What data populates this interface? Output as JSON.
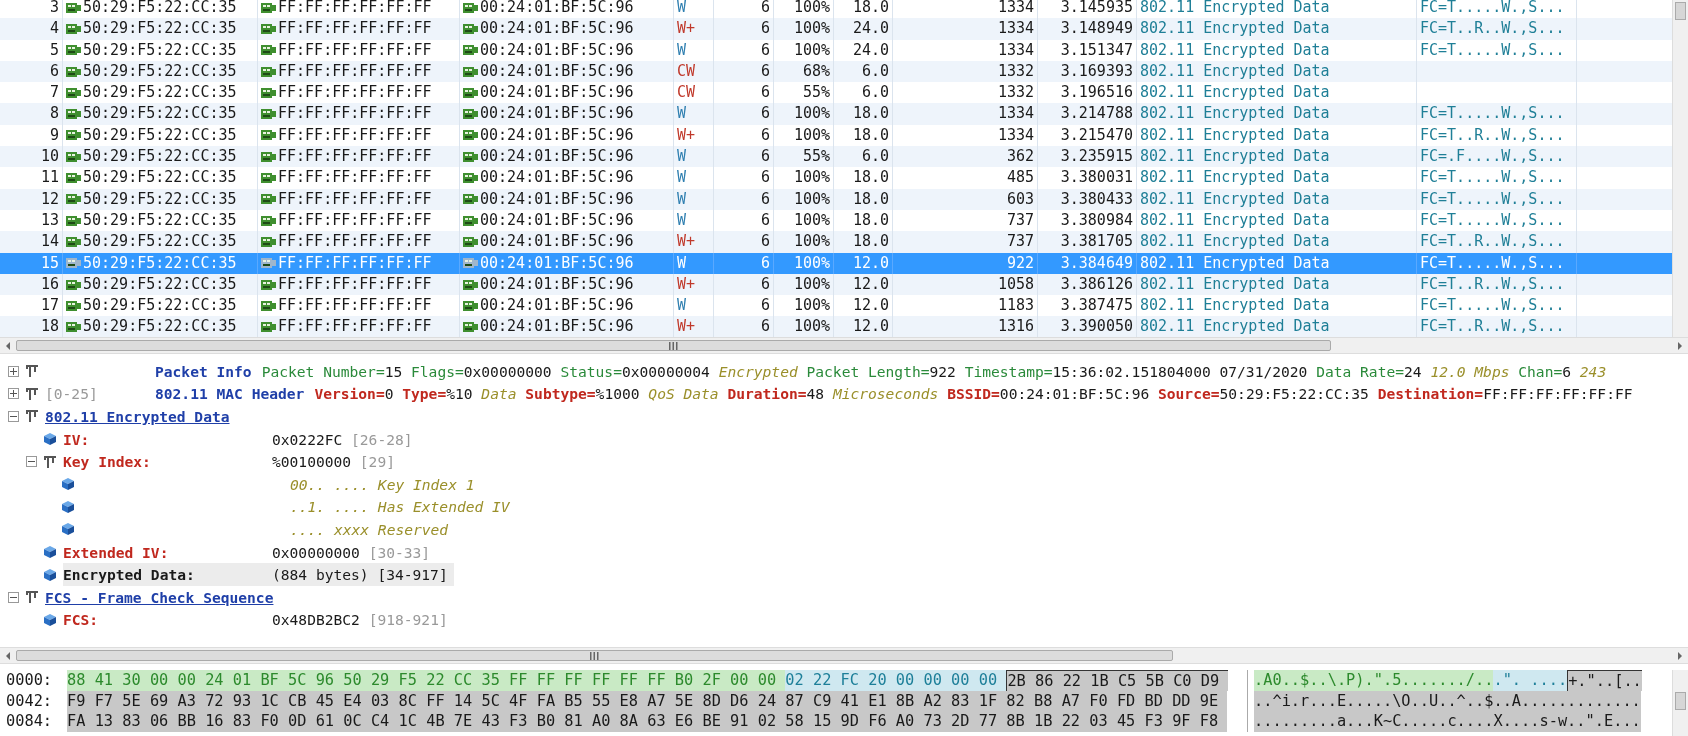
{
  "packet_list": {
    "rows": [
      {
        "selected": false,
        "color": "#2f7fb0",
        "cells": [
          "3",
          "50:29:F5:22:CC:35",
          "FF:FF:FF:FF:FF:FF",
          "00:24:01:BF:5C:96",
          "W",
          "6",
          "100%",
          "18.0",
          "1334",
          "3.145935",
          "802.11 Encrypted Data",
          "FC=T.....W.,S..."
        ]
      },
      {
        "selected": false,
        "color": "#c0392b",
        "cells": [
          "4",
          "50:29:F5:22:CC:35",
          "FF:FF:FF:FF:FF:FF",
          "00:24:01:BF:5C:96",
          "W+",
          "6",
          "100%",
          "24.0",
          "1334",
          "3.148949",
          "802.11 Encrypted Data",
          "FC=T..R..W.,S..."
        ]
      },
      {
        "selected": false,
        "color": "#2f7fb0",
        "cells": [
          "5",
          "50:29:F5:22:CC:35",
          "FF:FF:FF:FF:FF:FF",
          "00:24:01:BF:5C:96",
          "W",
          "6",
          "100%",
          "24.0",
          "1334",
          "3.151347",
          "802.11 Encrypted Data",
          "FC=T.....W.,S..."
        ]
      },
      {
        "selected": false,
        "color": "#c0392b",
        "cells": [
          "6",
          "50:29:F5:22:CC:35",
          "FF:FF:FF:FF:FF:FF",
          "00:24:01:BF:5C:96",
          "CW",
          "6",
          "68%",
          "6.0",
          "1332",
          "3.169393",
          "802.11 Encrypted Data"
        ]
      },
      {
        "selected": false,
        "color": "#c0392b",
        "cells": [
          "7",
          "50:29:F5:22:CC:35",
          "FF:FF:FF:FF:FF:FF",
          "00:24:01:BF:5C:96",
          "CW",
          "6",
          "55%",
          "6.0",
          "1332",
          "3.196516",
          "802.11 Encrypted Data"
        ]
      },
      {
        "selected": false,
        "color": "#2f7fb0",
        "cells": [
          "8",
          "50:29:F5:22:CC:35",
          "FF:FF:FF:FF:FF:FF",
          "00:24:01:BF:5C:96",
          "W",
          "6",
          "100%",
          "18.0",
          "1334",
          "3.214788",
          "802.11 Encrypted Data",
          "FC=T.....W.,S..."
        ]
      },
      {
        "selected": false,
        "color": "#c0392b",
        "cells": [
          "9",
          "50:29:F5:22:CC:35",
          "FF:FF:FF:FF:FF:FF",
          "00:24:01:BF:5C:96",
          "W+",
          "6",
          "100%",
          "18.0",
          "1334",
          "3.215470",
          "802.11 Encrypted Data",
          "FC=T..R..W.,S..."
        ]
      },
      {
        "selected": false,
        "color": "#2f7fb0",
        "cells": [
          "10",
          "50:29:F5:22:CC:35",
          "FF:FF:FF:FF:FF:FF",
          "00:24:01:BF:5C:96",
          "W",
          "6",
          "55%",
          "6.0",
          "362",
          "3.235915",
          "802.11 Encrypted Data",
          "FC=.F....W.,S..."
        ]
      },
      {
        "selected": false,
        "color": "#2f7fb0",
        "cells": [
          "11",
          "50:29:F5:22:CC:35",
          "FF:FF:FF:FF:FF:FF",
          "00:24:01:BF:5C:96",
          "W",
          "6",
          "100%",
          "18.0",
          "485",
          "3.380031",
          "802.11 Encrypted Data",
          "FC=T.....W.,S..."
        ]
      },
      {
        "selected": false,
        "color": "#2f7fb0",
        "cells": [
          "12",
          "50:29:F5:22:CC:35",
          "FF:FF:FF:FF:FF:FF",
          "00:24:01:BF:5C:96",
          "W",
          "6",
          "100%",
          "18.0",
          "603",
          "3.380433",
          "802.11 Encrypted Data",
          "FC=T.....W.,S..."
        ]
      },
      {
        "selected": false,
        "color": "#2f7fb0",
        "cells": [
          "13",
          "50:29:F5:22:CC:35",
          "FF:FF:FF:FF:FF:FF",
          "00:24:01:BF:5C:96",
          "W",
          "6",
          "100%",
          "18.0",
          "737",
          "3.380984",
          "802.11 Encrypted Data",
          "FC=T.....W.,S..."
        ]
      },
      {
        "selected": false,
        "color": "#c0392b",
        "cells": [
          "14",
          "50:29:F5:22:CC:35",
          "FF:FF:FF:FF:FF:FF",
          "00:24:01:BF:5C:96",
          "W+",
          "6",
          "100%",
          "18.0",
          "737",
          "3.381705",
          "802.11 Encrypted Data",
          "FC=T..R..W.,S..."
        ]
      },
      {
        "selected": true,
        "color": "#ffffff",
        "cells": [
          "15",
          "50:29:F5:22:CC:35",
          "FF:FF:FF:FF:FF:FF",
          "00:24:01:BF:5C:96",
          "W",
          "6",
          "100%",
          "12.0",
          "922",
          "3.384649",
          "802.11 Encrypted Data",
          "FC=T.....W.,S..."
        ]
      },
      {
        "selected": false,
        "color": "#c0392b",
        "cells": [
          "16",
          "50:29:F5:22:CC:35",
          "FF:FF:FF:FF:FF:FF",
          "00:24:01:BF:5C:96",
          "W+",
          "6",
          "100%",
          "12.0",
          "1058",
          "3.386126",
          "802.11 Encrypted Data",
          "FC=T..R..W.,S..."
        ]
      },
      {
        "selected": false,
        "color": "#2f7fb0",
        "cells": [
          "17",
          "50:29:F5:22:CC:35",
          "FF:FF:FF:FF:FF:FF",
          "00:24:01:BF:5C:96",
          "W",
          "6",
          "100%",
          "12.0",
          "1183",
          "3.387475",
          "802.11 Encrypted Data",
          "FC=T.....W.,S..."
        ]
      },
      {
        "selected": false,
        "color": "#c0392b",
        "cells": [
          "18",
          "50:29:F5:22:CC:35",
          "FF:FF:FF:FF:FF:FF",
          "00:24:01:BF:5C:96",
          "W+",
          "6",
          "100%",
          "12.0",
          "1316",
          "3.390050",
          "802.11 Encrypted Data",
          "FC=T..R..W.,S..."
        ]
      }
    ]
  },
  "decode_tree": [
    {
      "kind": "info",
      "expanded": false,
      "label": "Packet Info",
      "fields": [
        {
          "key": "Packet Number=",
          "value": "15"
        },
        {
          "key": "Flags=",
          "value": "0x00000000"
        },
        {
          "key": "Status=",
          "value": "0x00000004",
          "note": "Encrypted"
        },
        {
          "key": "Packet Length=",
          "value": "922"
        },
        {
          "key": "Timestamp=",
          "value": "15:36:02.151804000 07/31/2020"
        },
        {
          "key": "Data Rate=",
          "value": "24",
          "note": "12.0 Mbps"
        },
        {
          "key": "Chan=",
          "value": "6",
          "note": "243"
        }
      ]
    },
    {
      "kind": "header",
      "expanded": false,
      "range": "[0-25]",
      "label": "802.11 MAC Header",
      "fields": [
        {
          "key": "Version=",
          "value": "0"
        },
        {
          "key": "Type=",
          "value": "%10",
          "note": "Data"
        },
        {
          "key": "Subtype=",
          "value": "%1000",
          "note": "QoS Data"
        },
        {
          "key": "Duration=",
          "value": "48",
          "note": "Microseconds"
        },
        {
          "key": "BSSID=",
          "value": "00:24:01:BF:5C:96"
        },
        {
          "key": "Source=",
          "value": "50:29:F5:22:CC:35"
        },
        {
          "key": "Destination=",
          "value": "FF:FF:FF:FF:FF:FF"
        }
      ]
    },
    {
      "kind": "section",
      "expanded": true,
      "label": "802.11 Encrypted Data",
      "children": [
        {
          "kind": "field",
          "selected": false,
          "label": "IV:",
          "value": "0x0222FC",
          "range": "[26-28]"
        },
        {
          "kind": "field",
          "selected": false,
          "expanded": true,
          "label": "Key Index:",
          "value": "%00100000",
          "range": "[29]",
          "children": [
            {
              "kind": "bits",
              "text": "00.. .... Key Index 1"
            },
            {
              "kind": "bits",
              "text": "..1. .... Has Extended IV"
            },
            {
              "kind": "bits",
              "text": ".... xxxx Reserved"
            }
          ]
        },
        {
          "kind": "field",
          "selected": false,
          "label": "Extended IV:",
          "value": "0x00000000",
          "range": "[30-33]"
        },
        {
          "kind": "field",
          "selected": true,
          "label": "Encrypted Data:",
          "value": "(884 bytes)",
          "range": "[34-917]"
        }
      ]
    },
    {
      "kind": "section",
      "expanded": true,
      "label": "FCS - Frame Check Sequence",
      "children": [
        {
          "kind": "field",
          "selected": false,
          "label": "FCS:",
          "value": "0x48DB2BC2",
          "range": "[918-921]"
        }
      ]
    }
  ],
  "hex_dump": [
    {
      "offset": "0000:",
      "segments": [
        {
          "kind": "header",
          "hex": "88 41 30 00 00 24 01 BF 5C 96 50 29 F5 22 CC 35 FF FF FF FF FF FF B0 2F 00 00",
          "ascii": ".A0..$..\\.P).\".5......./.."
        },
        {
          "kind": "iv",
          "hex": "02 22 FC 20 00 00 00 00",
          "ascii": ".\". ...."
        },
        {
          "kind": "selected",
          "hex": "2B 86 22 1B C5 5B C0 D9",
          "ascii": "+.\"..[.."
        }
      ]
    },
    {
      "offset": "0042:",
      "segments": [
        {
          "kind": "selected",
          "hex": "F9 F7 5E 69 A3 72 93 1C CB 45 E4 03 8C FF 14 5C 4F FA B5 55 E8 A7 5E 8D D6 24 87 C9 41 E1 8B A2 83 1F 82 B8 A7 F0 FD BD DD 9E",
          "ascii": "..^i.r...E.....\\O..U..^..$..A............."
        }
      ]
    },
    {
      "offset": "0084:",
      "segments": [
        {
          "kind": "selected",
          "hex": "FA 13 83 06 BB 16 83 F0 0D 61 0C C4 1C 4B 7E 43 F3 B0 81 A0 8A 63 E6 BE 91 02 58 15 9D F6 A0 73 2D 77 8B 1B 22 03 45 F3 9F F8",
          "ascii": ".........a...K~C.....c....X....s-w..\".E..."
        }
      ]
    }
  ]
}
